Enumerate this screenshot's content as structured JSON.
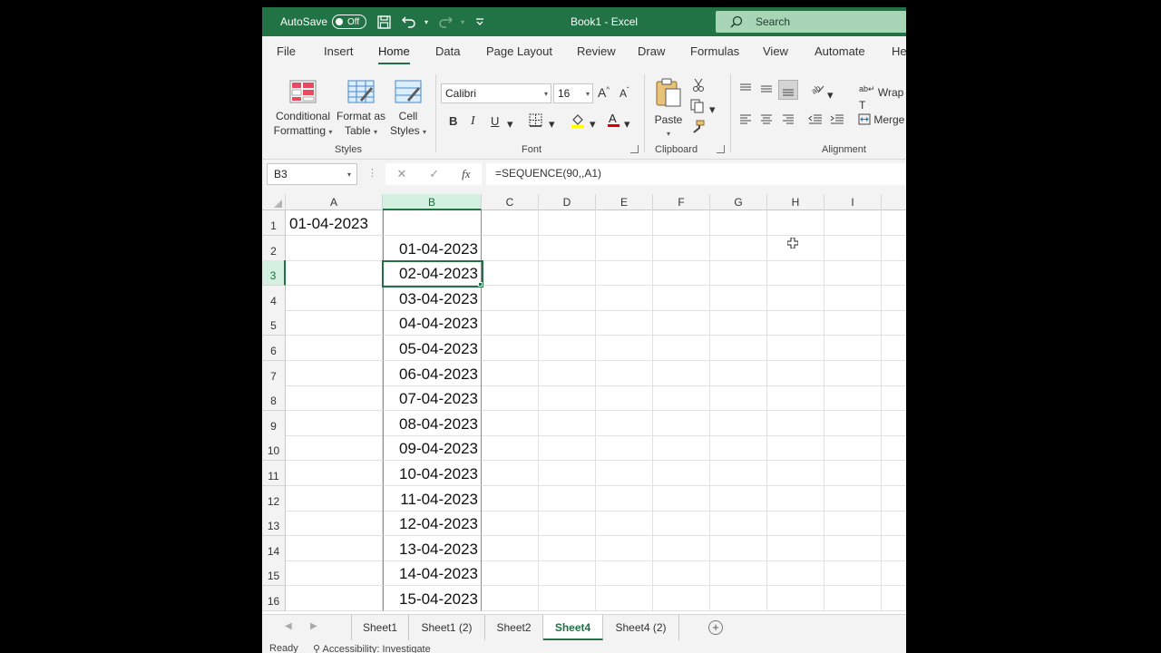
{
  "titlebar": {
    "autosave_label": "AutoSave",
    "autosave_state": "Off",
    "doc_title": "Book1  -  Excel",
    "search_placeholder": "Search"
  },
  "tabs": [
    "File",
    "Insert",
    "Home",
    "Data",
    "Page Layout",
    "Review",
    "Draw",
    "Formulas",
    "View",
    "Automate",
    "He"
  ],
  "active_tab": "Home",
  "ribbon": {
    "styles": {
      "conditional_formatting": [
        "Conditional",
        "Formatting"
      ],
      "format_as_table": [
        "Format as",
        "Table"
      ],
      "cell_styles": [
        "Cell",
        "Styles"
      ],
      "group_label": "Styles"
    },
    "font": {
      "font_name": "Calibri",
      "font_size": "16",
      "bold": "B",
      "italic": "I",
      "underline": "U",
      "group_label": "Font"
    },
    "clipboard": {
      "paste": "Paste",
      "group_label": "Clipboard"
    },
    "alignment": {
      "wrap_text": "Wrap T",
      "merge": "Merge",
      "group_label": "Alignment"
    }
  },
  "formula_bar": {
    "name_box": "B3",
    "formula": "=SEQUENCE(90,,A1)"
  },
  "columns": [
    "A",
    "B",
    "C",
    "D",
    "E",
    "F",
    "G",
    "H",
    "I"
  ],
  "selected_column": "B",
  "selected_row": 3,
  "rows": [
    {
      "n": "1",
      "a": "01-04-2023",
      "b": ""
    },
    {
      "n": "2",
      "a": "",
      "b": "01-04-2023"
    },
    {
      "n": "3",
      "a": "",
      "b": "02-04-2023"
    },
    {
      "n": "4",
      "a": "",
      "b": "03-04-2023"
    },
    {
      "n": "5",
      "a": "",
      "b": "04-04-2023"
    },
    {
      "n": "6",
      "a": "",
      "b": "05-04-2023"
    },
    {
      "n": "7",
      "a": "",
      "b": "06-04-2023"
    },
    {
      "n": "8",
      "a": "",
      "b": "07-04-2023"
    },
    {
      "n": "9",
      "a": "",
      "b": "08-04-2023"
    },
    {
      "n": "10",
      "a": "",
      "b": "09-04-2023"
    },
    {
      "n": "11",
      "a": "",
      "b": "10-04-2023"
    },
    {
      "n": "12",
      "a": "",
      "b": "11-04-2023"
    },
    {
      "n": "13",
      "a": "",
      "b": "12-04-2023"
    },
    {
      "n": "14",
      "a": "",
      "b": "13-04-2023"
    },
    {
      "n": "15",
      "a": "",
      "b": "14-04-2023"
    },
    {
      "n": "16",
      "a": "",
      "b": "15-04-2023"
    }
  ],
  "sheets": [
    "Sheet1",
    "Sheet1 (2)",
    "Sheet2",
    "Sheet4",
    "Sheet4 (2)"
  ],
  "active_sheet": "Sheet4",
  "status": {
    "ready": "Ready",
    "accessibility": "Accessibility: Investigate"
  },
  "colors": {
    "excel_green": "#217346",
    "search_bg": "#a8d5b6",
    "ribbon_bg": "#f3f3f3"
  }
}
